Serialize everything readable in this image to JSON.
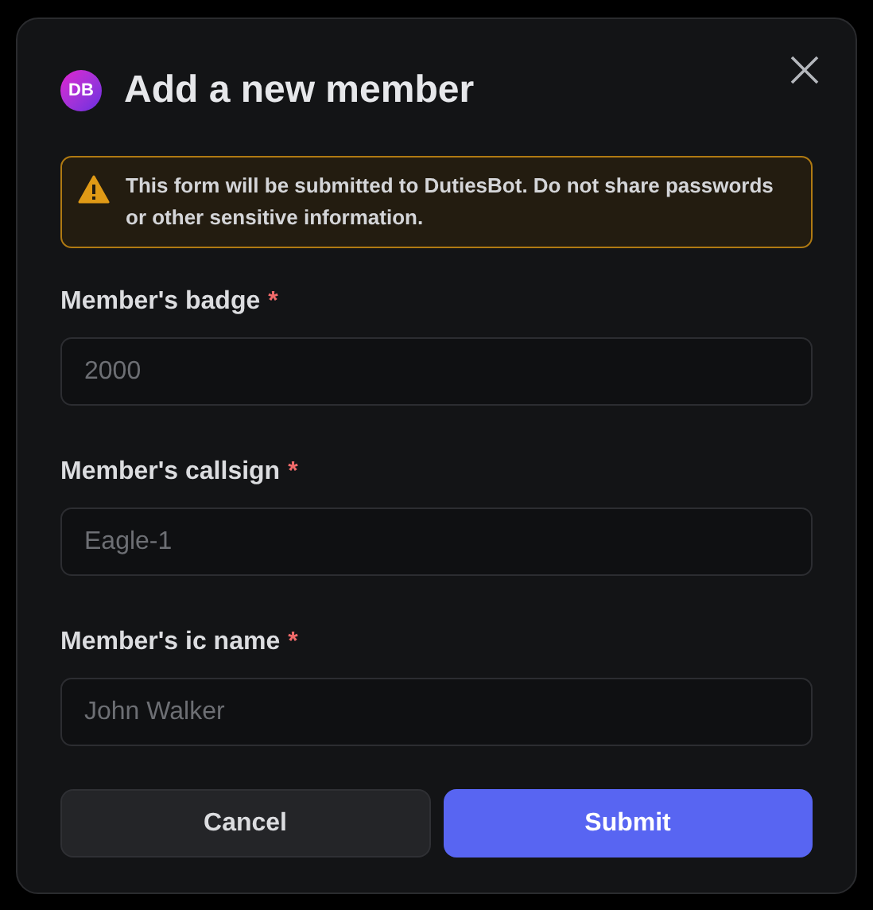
{
  "dialog": {
    "logo": "DB",
    "title": "Add a new member"
  },
  "warning": {
    "text": "This form will be submitted to **DutiesBot**. Do not share passwords or other sensitive information."
  },
  "fields": [
    {
      "label": "Member's badge",
      "required_mark": "*",
      "placeholder": "2000"
    },
    {
      "label": "Member's callsign",
      "required_mark": "*",
      "placeholder": "Eagle-1"
    },
    {
      "label": "Member's ic name",
      "required_mark": "*",
      "placeholder": "John Walker"
    }
  ],
  "buttons": [
    {
      "label": "Cancel",
      "kind": "secondary"
    },
    {
      "label": "Submit",
      "kind": "primary"
    }
  ]
}
